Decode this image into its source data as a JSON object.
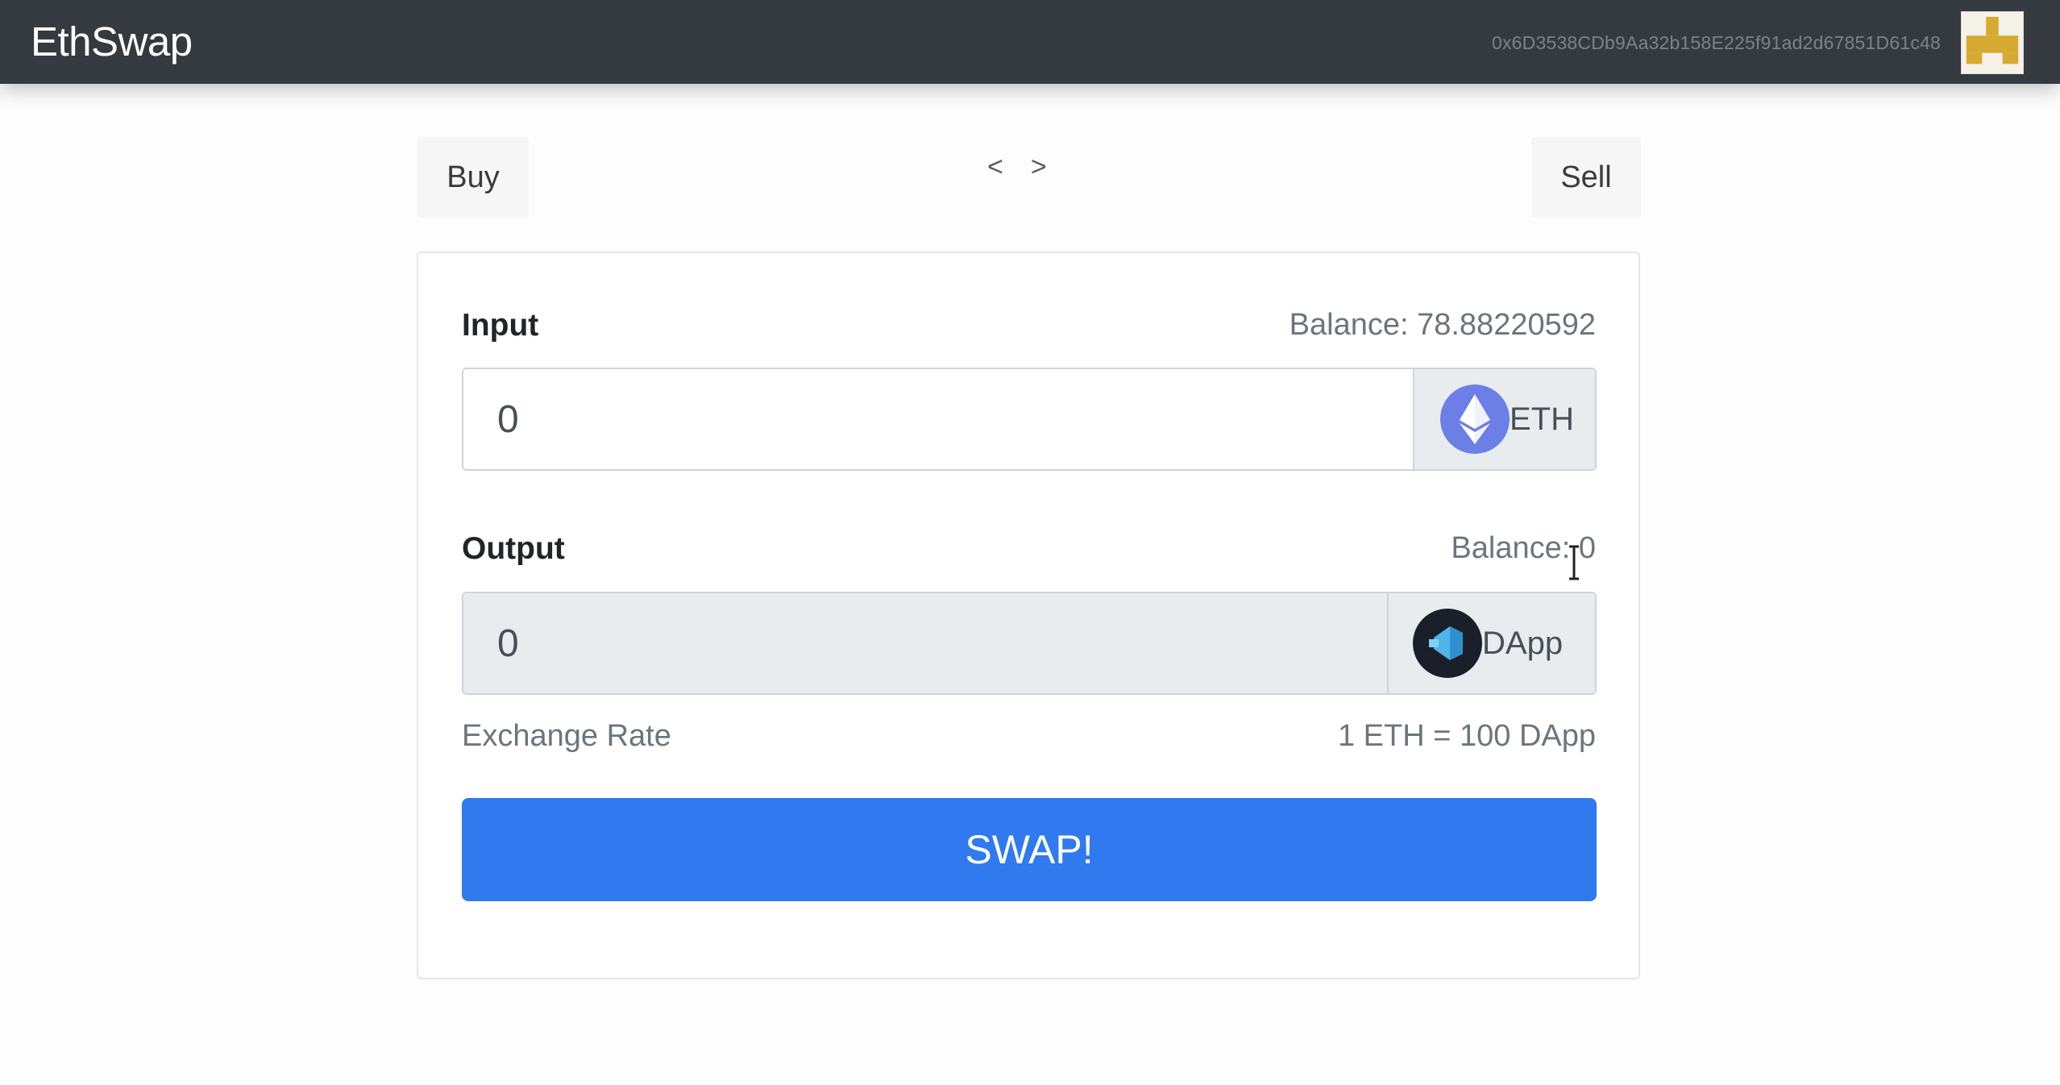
{
  "navbar": {
    "brand": "EthSwap",
    "account": "0x6D3538CDb9Aa32b158E225f91ad2d67851D61c48",
    "avatar_icon": "identicon"
  },
  "nav": {
    "buy_label": "Buy",
    "sell_label": "Sell",
    "prev_arrow": "<",
    "next_arrow": ">"
  },
  "form": {
    "input": {
      "label": "Input",
      "balance_text": "Balance: 78.88220592",
      "value": "0",
      "token": "ETH",
      "token_icon": "ethereum-icon"
    },
    "output": {
      "label": "Output",
      "balance_text": "Balance: 0",
      "value": "0",
      "token": "DApp",
      "token_icon": "dapp-token-icon"
    },
    "exchange_rate_label": "Exchange Rate",
    "exchange_rate_value": "1 ETH = 100 DApp",
    "swap_label": "SWAP!"
  },
  "colors": {
    "navbar_bg": "#343a40",
    "primary": "#3079ef",
    "eth_icon": "#6c7fe6",
    "dapp_icon_bg": "#1b1f2a",
    "dapp_icon_accent": "#4fb4e8",
    "identicon": "#d8a931"
  }
}
